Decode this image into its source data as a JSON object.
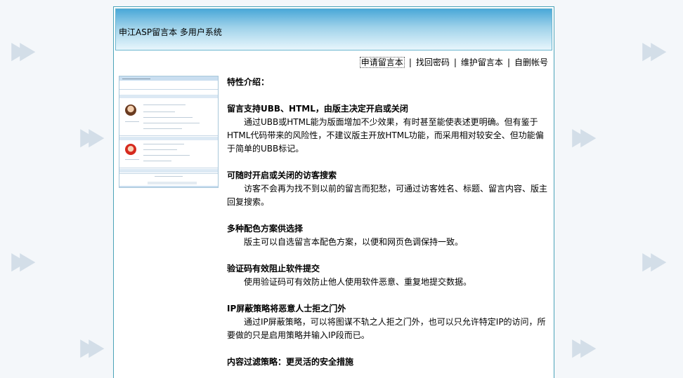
{
  "banner": {
    "title": "申江ASP留言本 多用户系统"
  },
  "nav": {
    "items": [
      {
        "label": "申请留言本",
        "active": true
      },
      {
        "label": "找回密码",
        "active": false
      },
      {
        "label": "维护留言本",
        "active": false
      },
      {
        "label": "自删帐号",
        "active": false
      }
    ],
    "separator": "|"
  },
  "features": {
    "intro": "特性介绍：",
    "items": [
      {
        "title": "留言支持UBB、HTML，由版主决定开启或关闭",
        "body": "通过UBB或HTML能为版面增加不少效果，有时甚至能使表述更明确。但有鉴于HTML代码带来的风险性，不建议版主开放HTML功能，而采用相对较安全、但功能偏于简单的UBB标记。"
      },
      {
        "title": "可随时开启或关闭的访客搜索",
        "body": "访客不会再为找不到以前的留言而犯愁，可通过访客姓名、标题、留言内容、版主回复搜索。"
      },
      {
        "title": "多种配色方案供选择",
        "body": "版主可以自选留言本配色方案，以便和网页色调保持一致。"
      },
      {
        "title": "验证码有效阻止软件提交",
        "body": "使用验证码可有效防止他人使用软件恶意、重复地提交数据。"
      },
      {
        "title": "IP屏蔽策略将恶意人士拒之门外",
        "body": "通过IP屏蔽策略，可以将图谋不轨之人拒之门外，也可以只允许特定IP的访问，所要做的只是启用策略并输入IP段而已。"
      },
      {
        "title": "内容过滤策略：更灵活的安全措施",
        "body": ""
      }
    ]
  },
  "watermark": {
    "glyph": "▶▶"
  },
  "colors": {
    "border": "#4ba3b9",
    "banner_top": "#4aa8d8",
    "banner_bottom": "#e8f6fc",
    "background": "#f4f7fa"
  }
}
